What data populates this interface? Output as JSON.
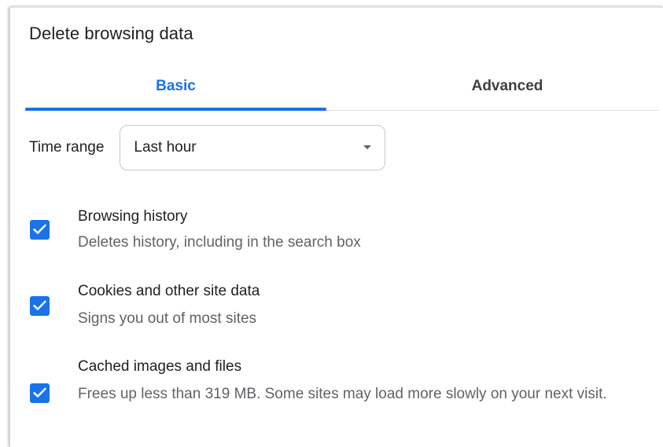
{
  "dialog": {
    "title": "Delete browsing data"
  },
  "tabs": [
    {
      "label": "Basic",
      "selected": true
    },
    {
      "label": "Advanced",
      "selected": false
    }
  ],
  "time_range": {
    "label": "Time range",
    "value": "Last hour"
  },
  "options": [
    {
      "title": "Browsing history",
      "description": "Deletes history, including in the search box",
      "checked": true
    },
    {
      "title": "Cookies and other site data",
      "description": "Signs you out of most sites",
      "checked": true
    },
    {
      "title": "Cached images and files",
      "description": "Frees up less than 319 MB. Some sites may load more slowly on your next visit.",
      "checked": true
    }
  ],
  "colors": {
    "accent": "#1a73e8",
    "text_primary": "#202124",
    "text_secondary": "#5f6368"
  }
}
